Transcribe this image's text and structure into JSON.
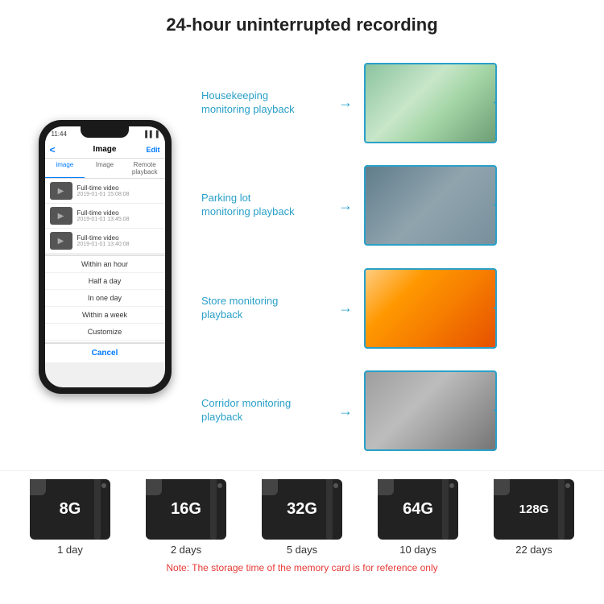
{
  "header": {
    "title": "24-hour uninterrupted recording"
  },
  "phone": {
    "status_time": "11:44",
    "nav_title": "Image",
    "nav_back": "<",
    "nav_edit": "Edit",
    "tabs": [
      "image",
      "Image",
      "Remote playback"
    ],
    "videos": [
      {
        "title": "Full-time video",
        "date": "2019-01-01 15:08:08"
      },
      {
        "title": "Full-time video",
        "date": "2019-01-01 13:45:08"
      },
      {
        "title": "Full-time video",
        "date": "2019-01-01 13:40:08"
      }
    ],
    "dropdown_items": [
      "Within an hour",
      "Half a day",
      "In one day",
      "Within a week",
      "Customize"
    ],
    "cancel_label": "Cancel"
  },
  "monitoring": [
    {
      "label": "Housekeeping\nmonitoring playback",
      "img_class": "img-housekeeping"
    },
    {
      "label": "Parking lot\nmonitoring playback",
      "img_class": "img-parking"
    },
    {
      "label": "Store monitoring\nplayback",
      "img_class": "img-store"
    },
    {
      "label": "Corridor monitoring\nplayback",
      "img_class": "img-corridor"
    }
  ],
  "sd_cards": [
    {
      "size": "8G",
      "days": "1 day"
    },
    {
      "size": "16G",
      "days": "2 days"
    },
    {
      "size": "32G",
      "days": "5 days"
    },
    {
      "size": "64G",
      "days": "10 days"
    },
    {
      "size": "128G",
      "days": "22 days"
    }
  ],
  "note": "Note: The storage time of the memory card is for reference only"
}
